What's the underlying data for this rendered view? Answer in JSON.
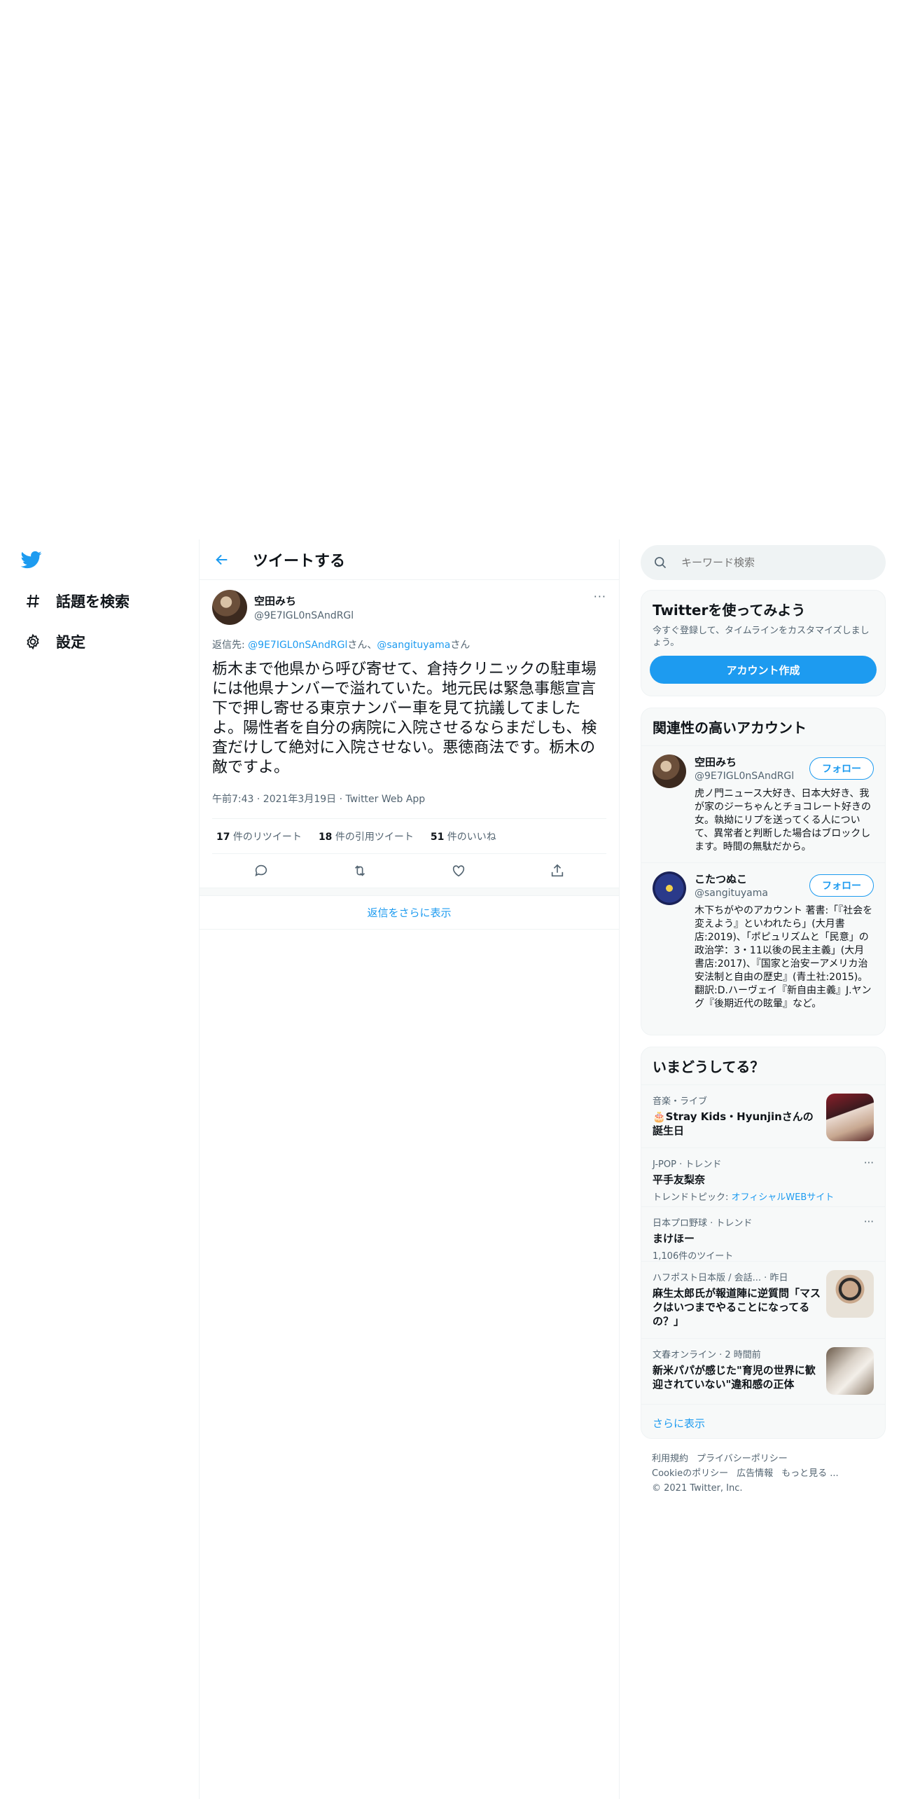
{
  "nav": {
    "explore_label": "話題を検索",
    "settings_label": "設定"
  },
  "header": {
    "title": "ツイートする"
  },
  "tweet": {
    "author_name": "空田みち",
    "author_handle": "@9E7IGL0nSAndRGl",
    "more": "···",
    "reply_prefix": "返信先: ",
    "reply_user1": "@9E7IGL0nSAndRGl",
    "reply_suffix1": "さん、",
    "reply_user2": "@sangituyama",
    "reply_suffix2": "さん",
    "body": "栃木まで他県から呼び寄せて、倉持クリニックの駐車場には他県ナンバーで溢れていた。地元民は緊急事態宣言下で押し寄せる東京ナンバー車を見て抗議してましたよ。陽性者を自分の病院に入院させるならまだしも、検査だけして絶対に入院させない。悪徳商法です。栃木の敵ですよ。",
    "meta": "午前7:43 · 2021年3月19日 · Twitter Web App",
    "retweets_count": "17",
    "retweets_label": " 件のリツイート",
    "quotes_count": "18",
    "quotes_label": " 件の引用ツイート",
    "likes_count": "51",
    "likes_label": " 件のいいね"
  },
  "show_more_replies": "返信をさらに表示",
  "search": {
    "placeholder": "キーワード検索"
  },
  "signup": {
    "title": "Twitterを使ってみよう",
    "subtitle": "今すぐ登録して、タイムラインをカスタマイズしましょう。",
    "button": "アカウント作成"
  },
  "related": {
    "title": "関連性の高いアカウント",
    "accounts": [
      {
        "name": "空田みち",
        "handle": "@9E7IGL0nSAndRGl",
        "follow": "フォロー",
        "bio": "虎ノ門ニュース大好き、日本大好き、我が家のジーちゃんとチョコレート好きの女。執拗にリプを送ってくる人について、異常者と判断した場合はブロックします。時間の無駄だから。"
      },
      {
        "name": "こたつぬこ",
        "handle": "@sangituyama",
        "follow": "フォロー",
        "bio": "木下ちがやのアカウント 著書:「『社会を変えよう』といわれたら」(大月書店:2019)、「ポピュリズムと「民意」の政治学：3・11以後の民主主義」(大月書店:2017)、『国家と治安ーアメリカ治安法制と自由の歴史』(青土社:2015)。翻訳:D.ハーヴェイ『新自由主義』J.ヤング『後期近代の眩暈』など。"
      }
    ]
  },
  "trends": {
    "title": "いまどうしてる？",
    "items": [
      {
        "category": "音楽・ライブ",
        "title": "🎂Stray Kids・Hyunjinさんの誕生日"
      },
      {
        "category": "J-POP · トレンド",
        "title": "平手友梨奈",
        "sub_prefix": "トレンドトピック: ",
        "sub_link": "オフィシャルWEBサイト"
      },
      {
        "category": "日本プロ野球 · トレンド",
        "title": "まけほー",
        "sub": "1,106件のツイート"
      },
      {
        "category": "ハフポスト日本版 / 会話... · 昨日",
        "title": "麻生太郎氏が報道陣に逆質問「マスクはいつまでやることになってるの？」"
      },
      {
        "category": "文春オンライン · 2 時間前",
        "title": "新米パパが感じた\"育児の世界に歓迎されていない\"違和感の正体"
      }
    ],
    "show_more": "さらに表示"
  },
  "footer": {
    "terms": "利用規約",
    "privacy": "プライバシーポリシー",
    "cookies": "Cookieのポリシー",
    "ads": "広告情報",
    "more": "もっと見る ...",
    "copyright": "© 2021 Twitter, Inc."
  },
  "colors": {
    "accent": "#1d9bf0",
    "text": "#0f1419",
    "secondary": "#536471"
  }
}
